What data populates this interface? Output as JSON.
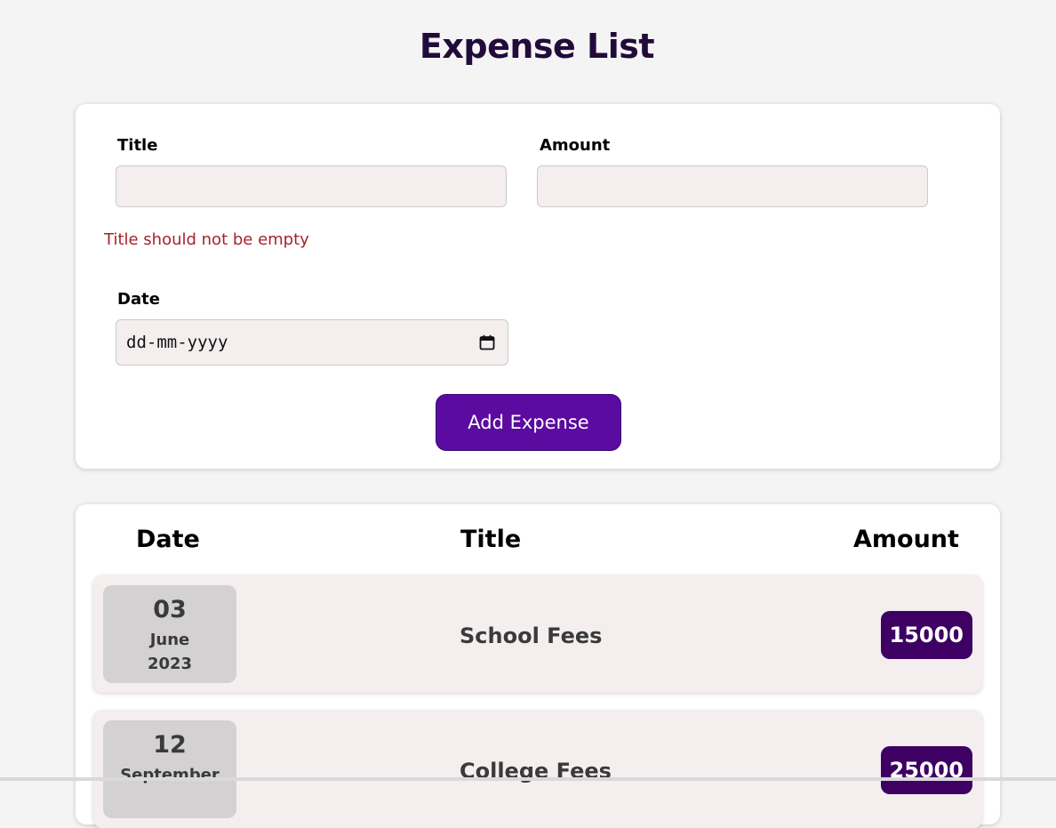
{
  "page": {
    "title": "Expense List"
  },
  "form": {
    "title_label": "Title",
    "title_value": "",
    "amount_label": "Amount",
    "amount_value": "",
    "error_message": "Title should not be empty",
    "date_label": "Date",
    "date_placeholder": "dd-mm-yyyy",
    "submit_label": "Add Expense"
  },
  "list": {
    "headers": {
      "date": "Date",
      "title": "Title",
      "amount": "Amount"
    },
    "items": [
      {
        "day": "03",
        "month": "June",
        "year": "2023",
        "title": "School Fees",
        "amount": "15000"
      },
      {
        "day": "12",
        "month": "September",
        "year": "",
        "title": "College Fees",
        "amount": "25000"
      }
    ]
  },
  "colors": {
    "accent": "#5b0ba0",
    "amount_badge": "#3e0063",
    "error": "#a8232a",
    "title": "#220b3a",
    "input_bg": "#f4eeee"
  },
  "icons": {
    "calendar": "calendar-icon"
  }
}
